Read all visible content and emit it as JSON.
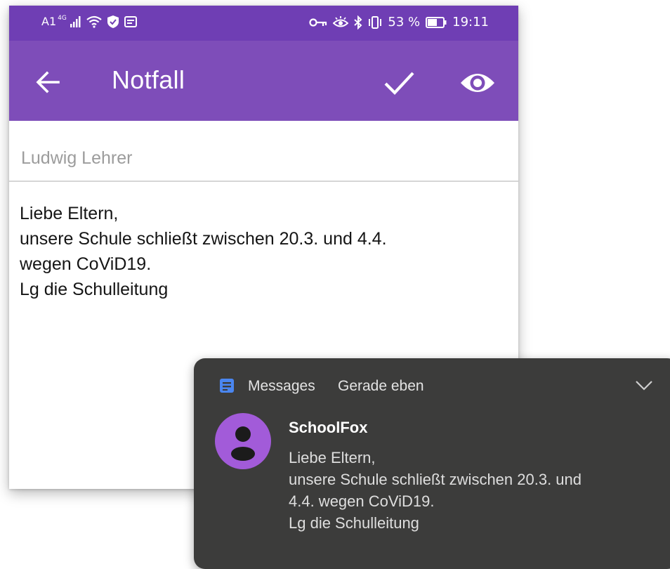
{
  "status_bar": {
    "carrier": "A1",
    "network": "4G",
    "battery_percent": "53 %",
    "time": "19:11"
  },
  "app_bar": {
    "title": "Notfall"
  },
  "compose": {
    "sender": "Ludwig Lehrer",
    "message_lines": [
      "Liebe Eltern,",
      "unsere Schule schließt zwischen 20.3. und 4.4.",
      "wegen CoViD19.",
      "Lg die Schulleitung"
    ]
  },
  "notification": {
    "app_name": "Messages",
    "time": "Gerade eben",
    "sender": "SchoolFox",
    "message_lines": [
      "Liebe Eltern,",
      "unsere Schule schließt zwischen 20.3. und",
      "4.4. wegen CoViD19.",
      "Lg die Schulleitung"
    ]
  },
  "colors": {
    "status_bar": "#6f3eb4",
    "app_bar": "#7e4db9",
    "notification_bg": "#3c3c3b",
    "avatar": "#a25bd9",
    "messages_icon": "#4a86f0"
  },
  "icons": {
    "back": "arrow-left-icon",
    "send": "check-icon",
    "preview": "eye-icon",
    "messages_app": "messages-app-icon",
    "expand": "chevron-down-icon",
    "avatar": "person-icon"
  }
}
